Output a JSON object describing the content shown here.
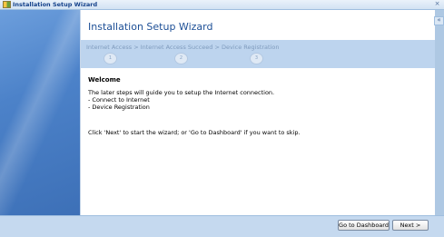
{
  "window": {
    "title": "Installation Setup Wizard",
    "close_icon": "×"
  },
  "wizard": {
    "title": "Installation Setup Wizard",
    "collapse_icon": "«",
    "steps_label": "Internet Access  >  Internet Access Succeed  >  Device Registration",
    "steps": [
      "1",
      "2",
      "3"
    ]
  },
  "content": {
    "heading": "Welcome",
    "intro": "The later steps will guide you to setup the Internet connection.",
    "item_1": "- Connect to Internet",
    "item_2": "- Device Registration",
    "instruction": "Click 'Next' to start the wizard; or 'Go to Dashboard' if you want to skip."
  },
  "buttons": {
    "dashboard": "Go to Dashboard",
    "next": "Next >"
  },
  "colors": {
    "accent": "#1d4f96",
    "steps_bar": "#bdd4ee",
    "left_strip": "#4c82c9"
  }
}
